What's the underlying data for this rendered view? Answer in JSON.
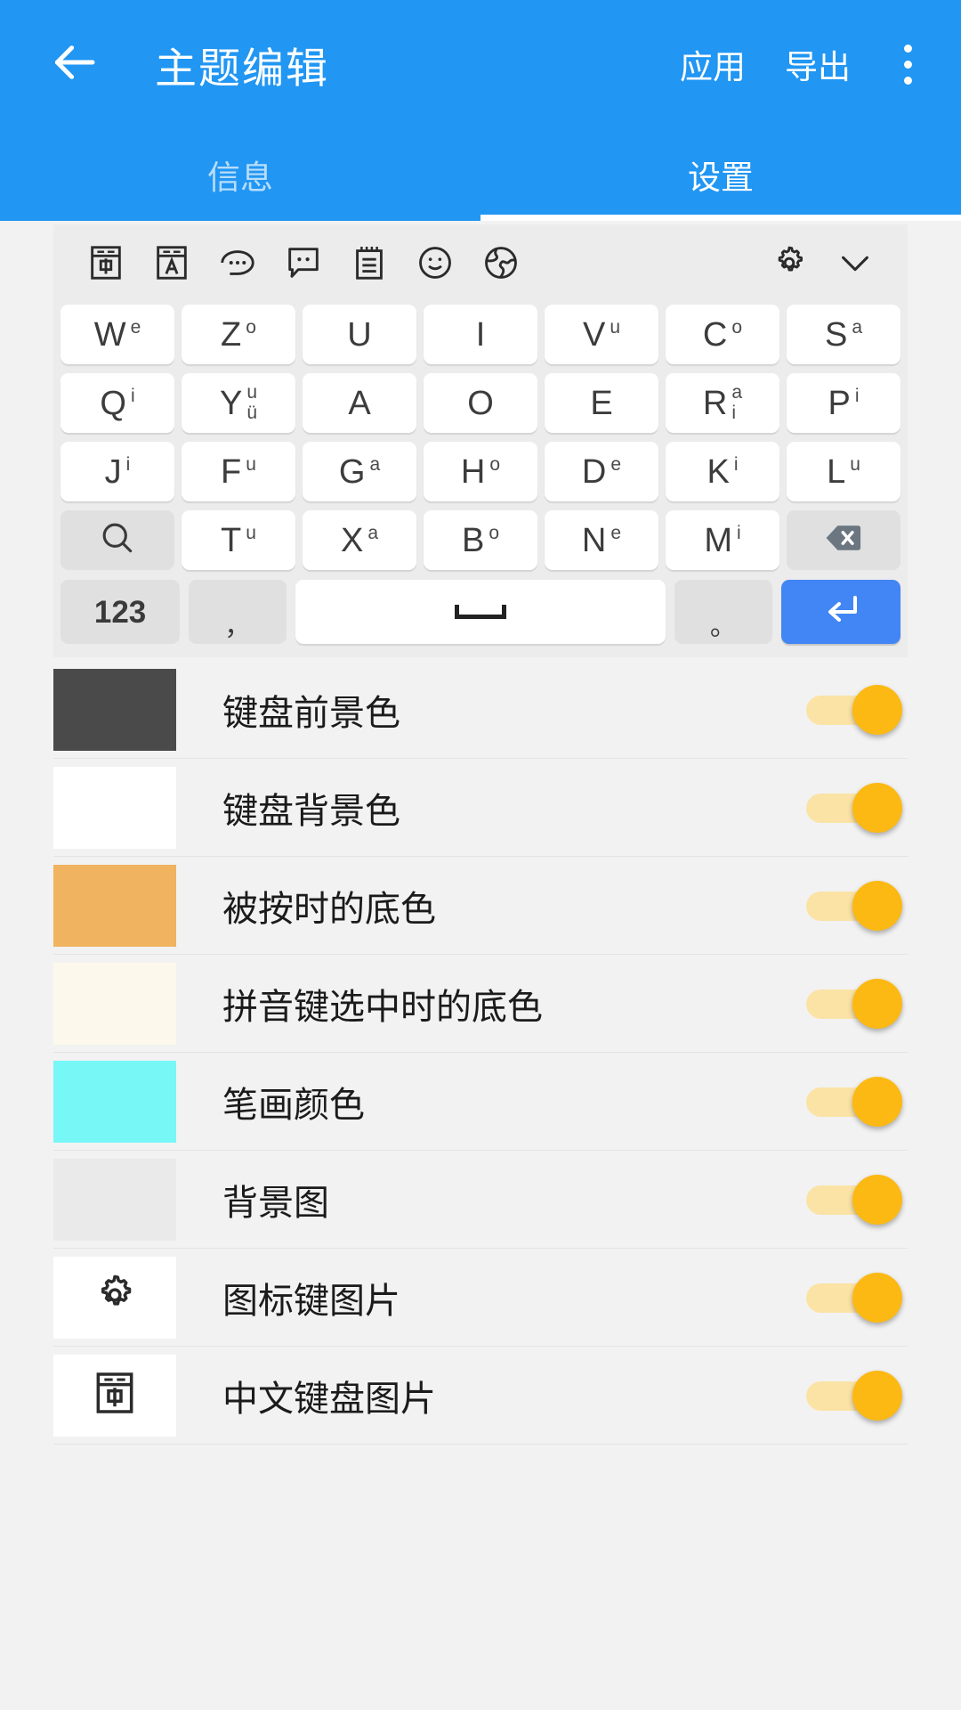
{
  "appbar": {
    "back_icon": "arrow-left-icon",
    "title": "主题编辑",
    "apply_label": "应用",
    "export_label": "导出",
    "overflow_icon": "more-vertical-icon",
    "background_color": "#2196f3"
  },
  "tabs": [
    {
      "label": "信息",
      "active": false
    },
    {
      "label": "设置",
      "active": true
    }
  ],
  "keyboard": {
    "toolbar_icons": [
      "chinese-input-icon",
      "english-input-icon",
      "speech-bubble-dots-icon",
      "chat-bubble-icon",
      "clipboard-notes-icon",
      "emoji-smiley-icon",
      "globe-icon"
    ],
    "toolbar_right_icons": [
      "gear-icon",
      "chevron-down-icon"
    ],
    "rows": [
      [
        {
          "main": "W",
          "subs": [
            "e"
          ]
        },
        {
          "main": "Z",
          "subs": [
            "o"
          ]
        },
        {
          "main": "U",
          "subs": []
        },
        {
          "main": "I",
          "subs": []
        },
        {
          "main": "V",
          "subs": [
            "u"
          ]
        },
        {
          "main": "C",
          "subs": [
            "o"
          ]
        },
        {
          "main": "S",
          "subs": [
            "a"
          ]
        }
      ],
      [
        {
          "main": "Q",
          "subs": [
            "i"
          ]
        },
        {
          "main": "Y",
          "subs": [
            "u",
            "ü"
          ]
        },
        {
          "main": "A",
          "subs": []
        },
        {
          "main": "O",
          "subs": []
        },
        {
          "main": "E",
          "subs": []
        },
        {
          "main": "R",
          "subs": [
            "a",
            "i"
          ]
        },
        {
          "main": "P",
          "subs": [
            "i"
          ]
        }
      ],
      [
        {
          "main": "J",
          "subs": [
            "i"
          ]
        },
        {
          "main": "F",
          "subs": [
            "u"
          ]
        },
        {
          "main": "G",
          "subs": [
            "a"
          ]
        },
        {
          "main": "H",
          "subs": [
            "o"
          ]
        },
        {
          "main": "D",
          "subs": [
            "e"
          ]
        },
        {
          "main": "K",
          "subs": [
            "i"
          ]
        },
        {
          "main": "L",
          "subs": [
            "u"
          ]
        }
      ],
      [
        {
          "main": "",
          "subs": [],
          "icon": "search-icon",
          "type": "fn"
        },
        {
          "main": "T",
          "subs": [
            "u"
          ]
        },
        {
          "main": "X",
          "subs": [
            "a"
          ]
        },
        {
          "main": "B",
          "subs": [
            "o"
          ]
        },
        {
          "main": "N",
          "subs": [
            "e"
          ]
        },
        {
          "main": "M",
          "subs": [
            "i"
          ]
        },
        {
          "main": "",
          "subs": [],
          "icon": "backspace-icon",
          "type": "fn"
        }
      ]
    ],
    "bottom_row": {
      "numeric_label": "123",
      "comma_label": "，",
      "space_icon": "space-bar-icon",
      "period_label": "。",
      "enter_icon": "enter-return-icon",
      "enter_color": "#4285f4"
    }
  },
  "settings": {
    "items": [
      {
        "label": "键盘前景色",
        "swatch_color": "#4a4a4a",
        "swatch_type": "color",
        "toggle_on": true
      },
      {
        "label": "键盘背景色",
        "swatch_color": "#ffffff",
        "swatch_type": "color",
        "toggle_on": true
      },
      {
        "label": "被按时的底色",
        "swatch_color": "#f0b35f",
        "swatch_type": "color",
        "toggle_on": true
      },
      {
        "label": "拼音键选中时的底色",
        "swatch_color": "#fdf8ec",
        "swatch_type": "color",
        "toggle_on": true
      },
      {
        "label": "笔画颜色",
        "swatch_color": "#78f7f7",
        "swatch_type": "color",
        "toggle_on": true
      },
      {
        "label": "背景图",
        "swatch_color": "#eaeaea",
        "swatch_type": "color",
        "toggle_on": true
      },
      {
        "label": "图标键图片",
        "swatch_color": "#ffffff",
        "swatch_type": "icon",
        "swatch_icon": "gear-icon",
        "toggle_on": true
      },
      {
        "label": "中文键盘图片",
        "swatch_color": "#ffffff",
        "swatch_type": "icon",
        "swatch_icon": "chinese-input-icon",
        "toggle_on": true
      }
    ],
    "toggle_track_color": "#fbe3a6",
    "toggle_thumb_color": "#fdb913"
  }
}
